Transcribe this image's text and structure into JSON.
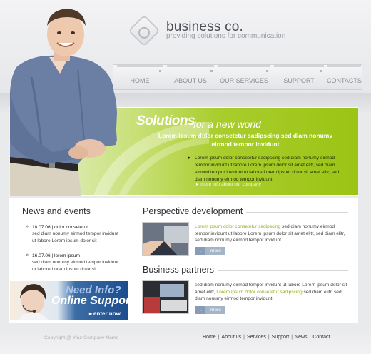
{
  "header": {
    "brand_name": "business co.",
    "tagline": "providing solutions for communication"
  },
  "nav": {
    "items": [
      {
        "label": "HOME"
      },
      {
        "label": "ABOUT US"
      },
      {
        "label": "OUR SERVICES"
      },
      {
        "label": "SUPPORT"
      },
      {
        "label": "CONTACTS"
      }
    ]
  },
  "hero": {
    "title_big": "Solutions",
    "title_small": "for a new world",
    "subtitle": "Lorem ipsum dolor consetetur sadipscing sed diam nonumy eirmod tempor invidunt",
    "bullet": "Lorem ipsum dolor consetetur sadipscing sed diam nonumy eirmod tempor invidunt ut labore Lorem ipsum dolor sit amet elitr, sed diam eirmod tempor invidunt ut labore Lorem ipsum dolor sit amet elitr, sed diam nonumy eirmod tempor invidunt",
    "more_link": "more info about our company"
  },
  "news": {
    "title": "News and events",
    "items": [
      {
        "date_line": "18.07.06  |  dolor consetetur",
        "body": "sed diam nonumy eirmod tempor invidunt ut labore Lorem ipsum dolor sit"
      },
      {
        "date_line": "16.07.06  |  lorem ipsum",
        "body": "sed diam nonumy eirmod tempor invidunt ut labore Lorem ipsum dolor sit"
      }
    ]
  },
  "banner": {
    "line1": "Need Info?",
    "line2": "Online Support",
    "cta": "enter now"
  },
  "perspective": {
    "title": "Perspective development",
    "highlight": "Lorem ipsum dolor consetetur sadipscing",
    "text": " sed diam nonumy eirmod tempor invidunt ut labore Lorem ipsum dolor sit amet elitr, sed diam  elitr, sed diam nonumy eirmod tempor invidunt",
    "more_label": "more"
  },
  "partners": {
    "title": "Business partners",
    "text_before": "sed diam nonumy eirmod tempor invidunt ut labore Lorem ipsum dolor sit amet elitr, ",
    "highlight": "Lorem ipsum dolor consetetur sadipscing",
    "text_after": " sed diam elitr, sed diam nonumy eirmod tempor invidunt",
    "more_label": "more"
  },
  "footer": {
    "copyright": "Copyright @ Your Company Name",
    "links": [
      "Home",
      "About us",
      "Services",
      "Support",
      "News",
      "Contact"
    ]
  },
  "colors": {
    "accent_green": "#9bc415",
    "highlight_green": "#8fb21b",
    "button_blue": "#a6b4c8"
  }
}
